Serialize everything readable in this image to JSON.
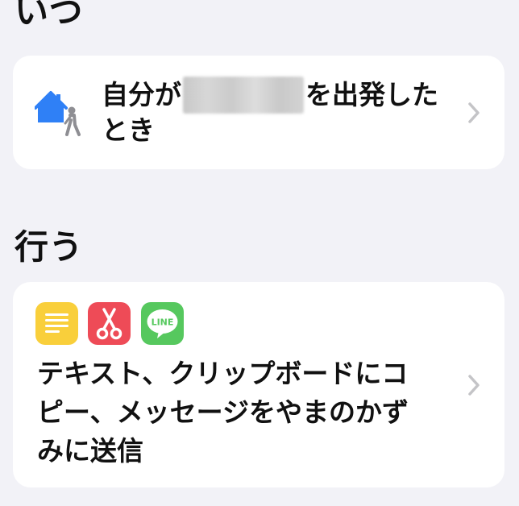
{
  "sections": {
    "when": {
      "title": "いつ",
      "trigger": {
        "line1_prefix": "自分が",
        "line1_suffix": "を出発した",
        "line2": "とき",
        "icon": "home-leave-icon"
      }
    },
    "do": {
      "title": "行う",
      "action": {
        "icons": [
          "notes-icon",
          "scissors-icon",
          "line-icon"
        ],
        "line_icon_label": "LINE",
        "line1": "テキスト、クリップボードにコ",
        "line2": "ピー、メッセージをやまのかず",
        "line3": "みに送信"
      }
    }
  },
  "colors": {
    "background": "#f2f2f7",
    "card": "#ffffff",
    "chevron": "#c4c4c7",
    "home_blue": "#2f80f6",
    "notes_yellow": "#f9cf3b",
    "scissors_red": "#ee4b57",
    "line_green": "#56c85e"
  }
}
